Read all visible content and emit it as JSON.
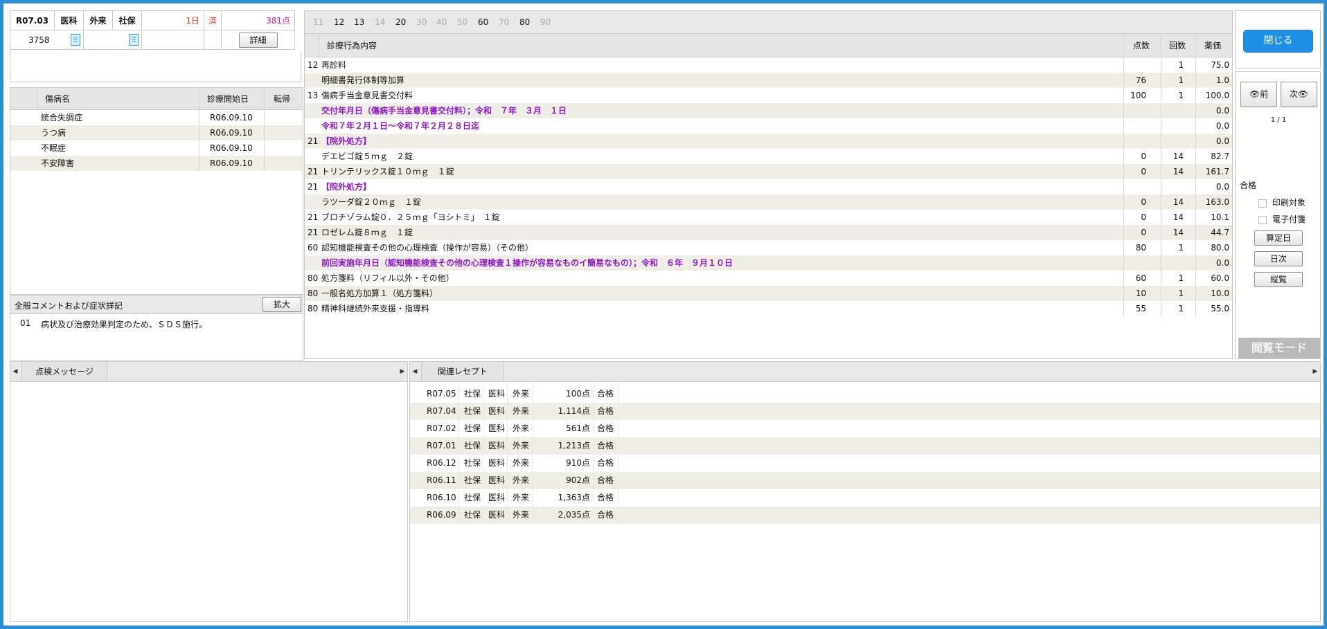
{
  "header": {
    "era_date": "R07.03",
    "dept": "医科",
    "visit_type": "外来",
    "insurance": "社保",
    "days": "1日",
    "status": "済",
    "points": "381点",
    "patient_no": "3758",
    "detail_btn": "詳細"
  },
  "disease": {
    "col_name": "傷病名",
    "col_start": "診療開始日",
    "col_outcome": "転帰",
    "rows": [
      {
        "name": "統合失調症",
        "start": "R06.09.10"
      },
      {
        "name": "うつ病",
        "start": "R06.09.10"
      },
      {
        "name": "不眠症",
        "start": "R06.09.10"
      },
      {
        "name": "不安障害",
        "start": "R06.09.10"
      }
    ]
  },
  "comment": {
    "title": "全般コメントおよび症状詳記",
    "expand_btn": "拡大",
    "code": "01",
    "text": "病状及び治療効果判定のため、ＳＤＳ施行。"
  },
  "tabs": [
    "11",
    "12",
    "13",
    "14",
    "20",
    "30",
    "40",
    "50",
    "60",
    "70",
    "80",
    "90"
  ],
  "treatment": {
    "col_content": "診療行為内容",
    "col_points": "点数",
    "col_times": "回数",
    "col_price": "薬価",
    "rows": [
      {
        "code": "12",
        "text": "再診料",
        "points": "",
        "times": "1",
        "price": "75.0",
        "style": ""
      },
      {
        "code": "",
        "text": "明細書発行体制等加算",
        "points": "76",
        "times": "1",
        "price": "1.0",
        "style": ""
      },
      {
        "code": "13",
        "text": "傷病手当金意見書交付料",
        "points": "100",
        "times": "1",
        "price": "100.0",
        "style": ""
      },
      {
        "code": "",
        "text": "交付年月日（傷病手当金意見書交付料）；令和　７年　３月　１日",
        "points": "",
        "times": "",
        "price": "0.0",
        "style": "purple"
      },
      {
        "code": "",
        "text": "令和７年２月１日～令和７年２月２８日迄",
        "points": "",
        "times": "",
        "price": "0.0",
        "style": "purple"
      },
      {
        "code": "21",
        "text": "【院外処方】",
        "points": "",
        "times": "",
        "price": "0.0",
        "style": "purple"
      },
      {
        "code": "",
        "text": "デエビゴ錠５ｍｇ　２錠",
        "points": "0",
        "times": "14",
        "price": "82.7",
        "style": ""
      },
      {
        "code": "21",
        "text": "トリンテリックス錠１０ｍｇ　１錠",
        "points": "0",
        "times": "14",
        "price": "161.7",
        "style": ""
      },
      {
        "code": "21",
        "text": "【院外処方】",
        "points": "",
        "times": "",
        "price": "0.0",
        "style": "purple"
      },
      {
        "code": "",
        "text": "ラツーダ錠２０ｍｇ　１錠",
        "points": "0",
        "times": "14",
        "price": "163.0",
        "style": ""
      },
      {
        "code": "21",
        "text": "ブロチゾラム錠０．２５ｍｇ「ヨシトミ」　１錠",
        "points": "0",
        "times": "14",
        "price": "10.1",
        "style": ""
      },
      {
        "code": "21",
        "text": "ロゼレム錠８ｍｇ　１錠",
        "points": "0",
        "times": "14",
        "price": "44.7",
        "style": ""
      },
      {
        "code": "60",
        "text": "認知機能検査その他の心理検査（操作が容易）（その他）",
        "points": "80",
        "times": "1",
        "price": "80.0",
        "style": ""
      },
      {
        "code": "",
        "text": "前回実施年月日（認知機能検査その他の心理検査１操作が容易なものイ簡易なもの）；令和　６年　９月１０日",
        "points": "",
        "times": "",
        "price": "0.0",
        "style": "purple"
      },
      {
        "code": "80",
        "text": "処方箋料（リフィル以外・その他）",
        "points": "60",
        "times": "1",
        "price": "60.0",
        "style": ""
      },
      {
        "code": "80",
        "text": "一般名処方加算１（処方箋料）",
        "points": "10",
        "times": "1",
        "price": "10.0",
        "style": ""
      },
      {
        "code": "80",
        "text": "精神科継続外来支援・指導料",
        "points": "55",
        "times": "1",
        "price": "55.0",
        "style": ""
      }
    ]
  },
  "right": {
    "close_btn": "閉じる",
    "prev_btn": "前",
    "next_btn": "次",
    "page": "1 / 1",
    "result": "合格",
    "print_target": "印刷対象",
    "e_attach": "電子付箋",
    "calc_day_btn": "算定日",
    "daily_btn": "日次",
    "vertical_btn": "縦覧",
    "mode": "閲覧モード"
  },
  "check_tab": "点検メッセージ",
  "related_tab": "関連レセプト",
  "related": [
    {
      "ym": "R07.05",
      "ins": "社保",
      "dept": "医科",
      "type": "外来",
      "pts": "100点",
      "res": "合格"
    },
    {
      "ym": "R07.04",
      "ins": "社保",
      "dept": "医科",
      "type": "外来",
      "pts": "1,114点",
      "res": "合格"
    },
    {
      "ym": "R07.02",
      "ins": "社保",
      "dept": "医科",
      "type": "外来",
      "pts": "561点",
      "res": "合格"
    },
    {
      "ym": "R07.01",
      "ins": "社保",
      "dept": "医科",
      "type": "外来",
      "pts": "1,213点",
      "res": "合格"
    },
    {
      "ym": "R06.12",
      "ins": "社保",
      "dept": "医科",
      "type": "外来",
      "pts": "910点",
      "res": "合格"
    },
    {
      "ym": "R06.11",
      "ins": "社保",
      "dept": "医科",
      "type": "外来",
      "pts": "902点",
      "res": "合格"
    },
    {
      "ym": "R06.10",
      "ins": "社保",
      "dept": "医科",
      "type": "外来",
      "pts": "1,363点",
      "res": "合格"
    },
    {
      "ym": "R06.09",
      "ins": "社保",
      "dept": "医科",
      "type": "外来",
      "pts": "2,035点",
      "res": "合格"
    }
  ]
}
